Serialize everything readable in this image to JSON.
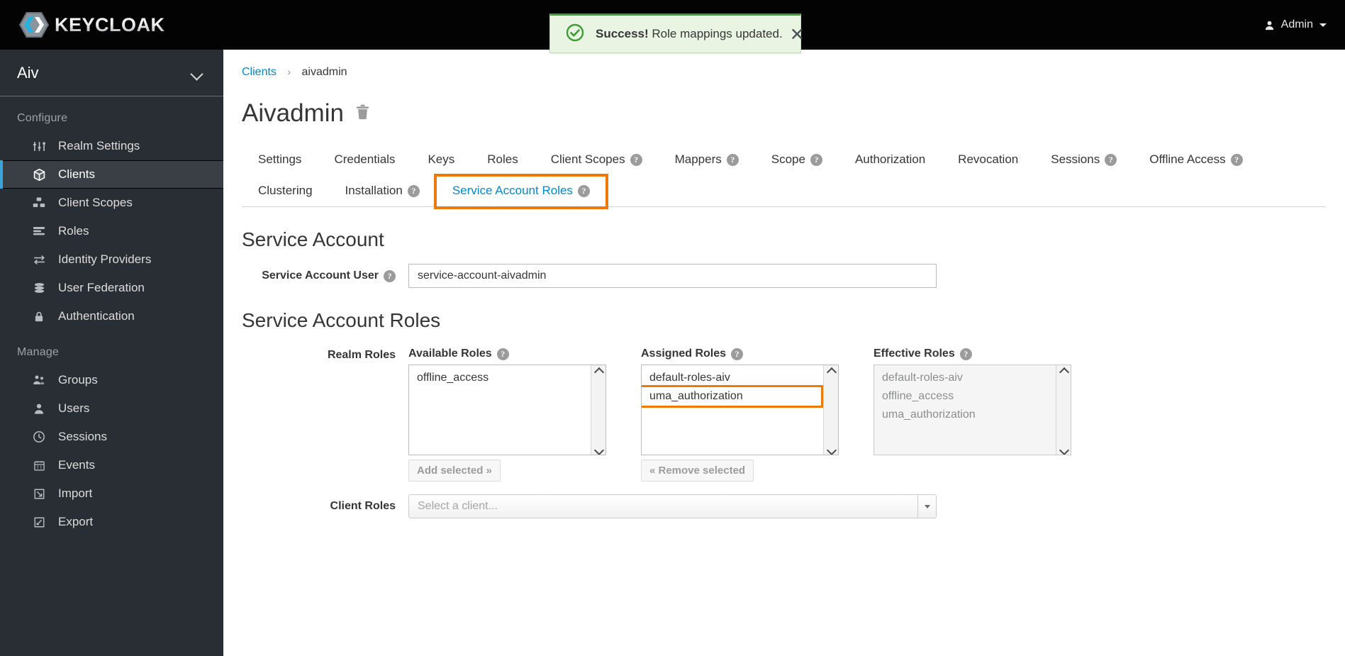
{
  "masthead": {
    "brand_name": "KEYCLOAK",
    "admin_label": "Admin"
  },
  "alert": {
    "strong": "Success!",
    "message": " Role mappings updated.",
    "close_label": "✕"
  },
  "sidebar": {
    "realm": "Aiv",
    "groups": [
      {
        "title": "Configure",
        "items": [
          {
            "label": "Realm Settings",
            "icon": "sliders-icon",
            "active": false
          },
          {
            "label": "Clients",
            "icon": "cube-icon",
            "active": true
          },
          {
            "label": "Client Scopes",
            "icon": "blocks-icon",
            "active": false
          },
          {
            "label": "Roles",
            "icon": "list-icon",
            "active": false
          },
          {
            "label": "Identity Providers",
            "icon": "exchange-icon",
            "active": false
          },
          {
            "label": "User Federation",
            "icon": "database-icon",
            "active": false
          },
          {
            "label": "Authentication",
            "icon": "lock-icon",
            "active": false
          }
        ]
      },
      {
        "title": "Manage",
        "items": [
          {
            "label": "Groups",
            "icon": "users-icon",
            "active": false
          },
          {
            "label": "Users",
            "icon": "user-icon",
            "active": false
          },
          {
            "label": "Sessions",
            "icon": "clock-icon",
            "active": false
          },
          {
            "label": "Events",
            "icon": "calendar-icon",
            "active": false
          },
          {
            "label": "Import",
            "icon": "import-icon",
            "active": false
          },
          {
            "label": "Export",
            "icon": "export-icon",
            "active": false
          }
        ]
      }
    ]
  },
  "breadcrumb": {
    "parent": "Clients",
    "separator": "›",
    "current": "aivadmin"
  },
  "page": {
    "title": "Aivadmin"
  },
  "tabs": [
    {
      "label": "Settings",
      "help": false,
      "active": false,
      "highlight": false
    },
    {
      "label": "Credentials",
      "help": false,
      "active": false,
      "highlight": false
    },
    {
      "label": "Keys",
      "help": false,
      "active": false,
      "highlight": false
    },
    {
      "label": "Roles",
      "help": false,
      "active": false,
      "highlight": false
    },
    {
      "label": "Client Scopes",
      "help": true,
      "active": false,
      "highlight": false
    },
    {
      "label": "Mappers",
      "help": true,
      "active": false,
      "highlight": false
    },
    {
      "label": "Scope",
      "help": true,
      "active": false,
      "highlight": false
    },
    {
      "label": "Authorization",
      "help": false,
      "active": false,
      "highlight": false
    },
    {
      "label": "Revocation",
      "help": false,
      "active": false,
      "highlight": false
    },
    {
      "label": "Sessions",
      "help": true,
      "active": false,
      "highlight": false
    },
    {
      "label": "Offline Access",
      "help": true,
      "active": false,
      "highlight": false
    },
    {
      "label": "Clustering",
      "help": false,
      "active": false,
      "highlight": false
    },
    {
      "label": "Installation",
      "help": true,
      "active": false,
      "highlight": false
    },
    {
      "label": "Service Account Roles",
      "help": true,
      "active": true,
      "highlight": true
    }
  ],
  "service_account": {
    "section_title": "Service Account",
    "user_label": "Service Account User",
    "user_value": "service-account-aivadmin"
  },
  "service_account_roles": {
    "section_title": "Service Account Roles",
    "realm_roles_label": "Realm Roles",
    "client_roles_label": "Client Roles",
    "client_select_placeholder": "Select a client...",
    "available": {
      "title": "Available Roles",
      "items": [
        "offline_access"
      ],
      "button": "Add selected »"
    },
    "assigned": {
      "title": "Assigned Roles",
      "items": [
        "default-roles-aiv",
        "uma_authorization"
      ],
      "highlighted_index": 1,
      "button": "« Remove selected"
    },
    "effective": {
      "title": "Effective Roles",
      "items": [
        "default-roles-aiv",
        "offline_access",
        "uma_authorization"
      ]
    }
  },
  "colors": {
    "accent_blue": "#0088ce",
    "highlight_orange": "#ec7a08",
    "success_green": "#3f9c35",
    "sidebar_bg": "#292e34"
  }
}
